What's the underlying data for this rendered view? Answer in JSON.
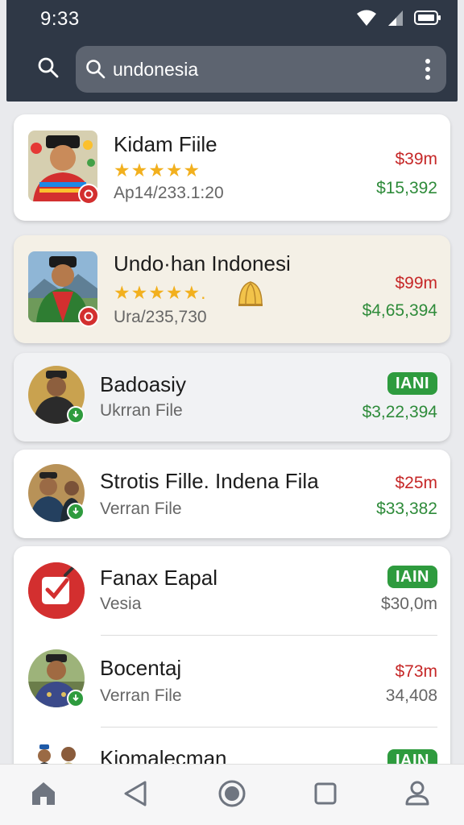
{
  "status_bar": {
    "time": "9:33"
  },
  "search": {
    "query": "undonesia"
  },
  "results": [
    {
      "title": "Kidam Fiile",
      "rating_stars": "★★★★★",
      "subtitle": "Ap14/233.1:20",
      "price_primary": "$39m",
      "price_secondary": "$15,392"
    },
    {
      "title": "Undo·han Indonesi",
      "rating_stars": "★★★★★.",
      "subtitle": "Ura/235,730",
      "price_primary": "$99m",
      "price_secondary": "$4,65,394"
    },
    {
      "title": "Badoasiy",
      "subtitle": "Ukrran File",
      "badge": "IANI",
      "price_secondary": "$3,22,394"
    },
    {
      "title": "Strotis Fille. Indena Fila",
      "subtitle": "Verran File",
      "price_primary": "$25m",
      "price_secondary": "$33,382"
    },
    {
      "title": "Fanax Eapal",
      "subtitle": "Vesia",
      "badge": "IAIN",
      "price_secondary": "$30,0m"
    },
    {
      "title": "Bocentaj",
      "subtitle": "Verran File",
      "price_primary": "$73m",
      "price_secondary": "34,408"
    },
    {
      "title": "Kiomalecman",
      "badge": "IAIN"
    }
  ],
  "colors": {
    "header": "#2f3846",
    "price_red": "#c62828",
    "price_green": "#2e8b3a",
    "badge_green": "#2e9b3e",
    "star": "#f2b01e"
  },
  "icons": {
    "nav": [
      "home-icon",
      "back-icon",
      "home-circle-icon",
      "recents-icon",
      "profile-icon"
    ]
  }
}
